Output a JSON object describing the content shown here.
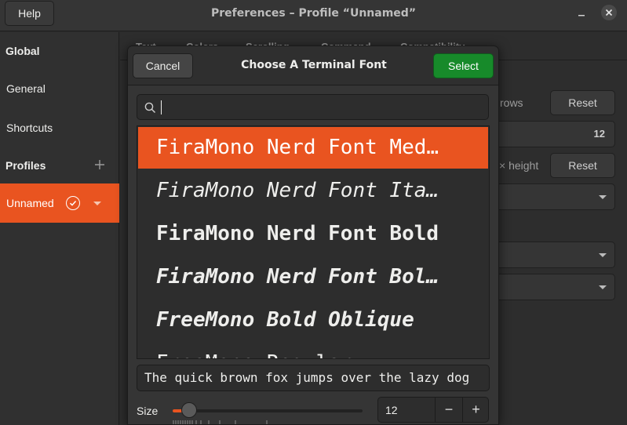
{
  "window": {
    "title": "Preferences – Profile “Unnamed”",
    "help_label": "Help"
  },
  "sidebar": {
    "global_heading": "Global",
    "items": [
      {
        "label": "General"
      },
      {
        "label": "Shortcuts"
      }
    ],
    "profiles_heading": "Profiles",
    "selected_profile": "Unnamed"
  },
  "main": {
    "tabs": [
      "Text",
      "Colors",
      "Scrolling",
      "Command",
      "Compatibility"
    ],
    "rows_label": "rows",
    "height_label": "× height",
    "reset_label": "Reset",
    "size_value_bg": "12"
  },
  "dialog": {
    "title": "Choose A Terminal Font",
    "cancel_label": "Cancel",
    "select_label": "Select",
    "search_value": "",
    "fonts": [
      {
        "label": "FiraMono Nerd Font Med…",
        "style": "normal",
        "weight": "normal",
        "selected": true
      },
      {
        "label": "FiraMono Nerd Font Ita…",
        "style": "italic",
        "weight": "normal",
        "selected": false
      },
      {
        "label": "FiraMono Nerd Font Bold",
        "style": "normal",
        "weight": "bold",
        "selected": false
      },
      {
        "label": "FiraMono Nerd Font Bol…",
        "style": "italic",
        "weight": "bold",
        "selected": false
      },
      {
        "label": "FreeMono Bold Oblique",
        "style": "italic",
        "weight": "bold",
        "selected": false
      },
      {
        "label": "FreeMono Regular",
        "style": "normal",
        "weight": "normal",
        "selected": false
      }
    ],
    "preview_text": "The quick brown fox jumps over the lazy dog",
    "size_label": "Size",
    "size_value": "12",
    "size_minus": "−",
    "size_plus": "+",
    "slider_level": 0.08
  },
  "colors": {
    "accent": "#e95420",
    "select_button": "#178a2a",
    "background": "#2b2b2b"
  }
}
